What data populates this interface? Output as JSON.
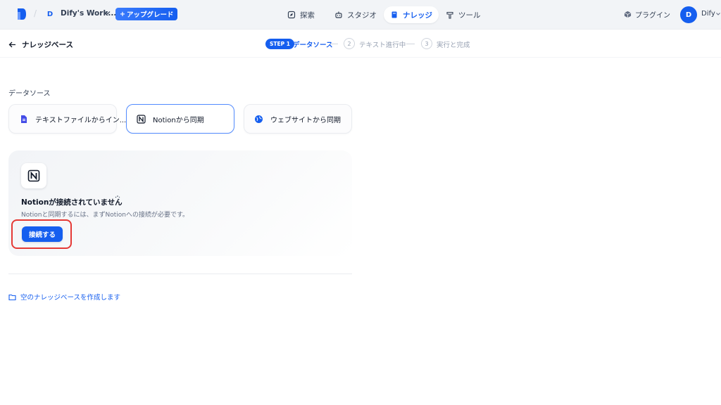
{
  "header": {
    "workspace_initial": "D",
    "workspace_name": "Dify's Work...",
    "upgrade_label": "アップグレード",
    "nav": [
      {
        "label": "探索",
        "icon": "compass-icon"
      },
      {
        "label": "スタジオ",
        "icon": "robot-icon"
      },
      {
        "label": "ナレッジ",
        "icon": "book-icon",
        "active": true
      },
      {
        "label": "ツール",
        "icon": "hammer-icon"
      }
    ],
    "plugin_label": "プラグイン",
    "user_initial": "D",
    "user_name": "Dify"
  },
  "subheader": {
    "back_label": "ナレッジベース",
    "steps": [
      {
        "badge": "STEP 1",
        "label": "データソース",
        "state": "active"
      },
      {
        "num": "2",
        "label": "テキスト進行中",
        "state": "pending"
      },
      {
        "num": "3",
        "label": "実行と完成",
        "state": "pending"
      }
    ]
  },
  "main": {
    "section_label": "データソース",
    "sources": [
      {
        "label": "テキストファイルからイン...",
        "icon": "file-icon",
        "selected": false
      },
      {
        "label": "Notionから同期",
        "icon": "notion-icon",
        "selected": true
      },
      {
        "label": "ウェブサイトから同期",
        "icon": "globe-icon",
        "selected": false
      }
    ],
    "notion_panel": {
      "title": "Notionが接続されていません",
      "description": "Notionと同期するには、まずNotionへの接続が必要です。",
      "connect_label": "接続する"
    },
    "empty_kb_label": "空のナレッジベースを作成します"
  },
  "colors": {
    "accent": "#155eef",
    "highlight_box": "#e53935"
  }
}
